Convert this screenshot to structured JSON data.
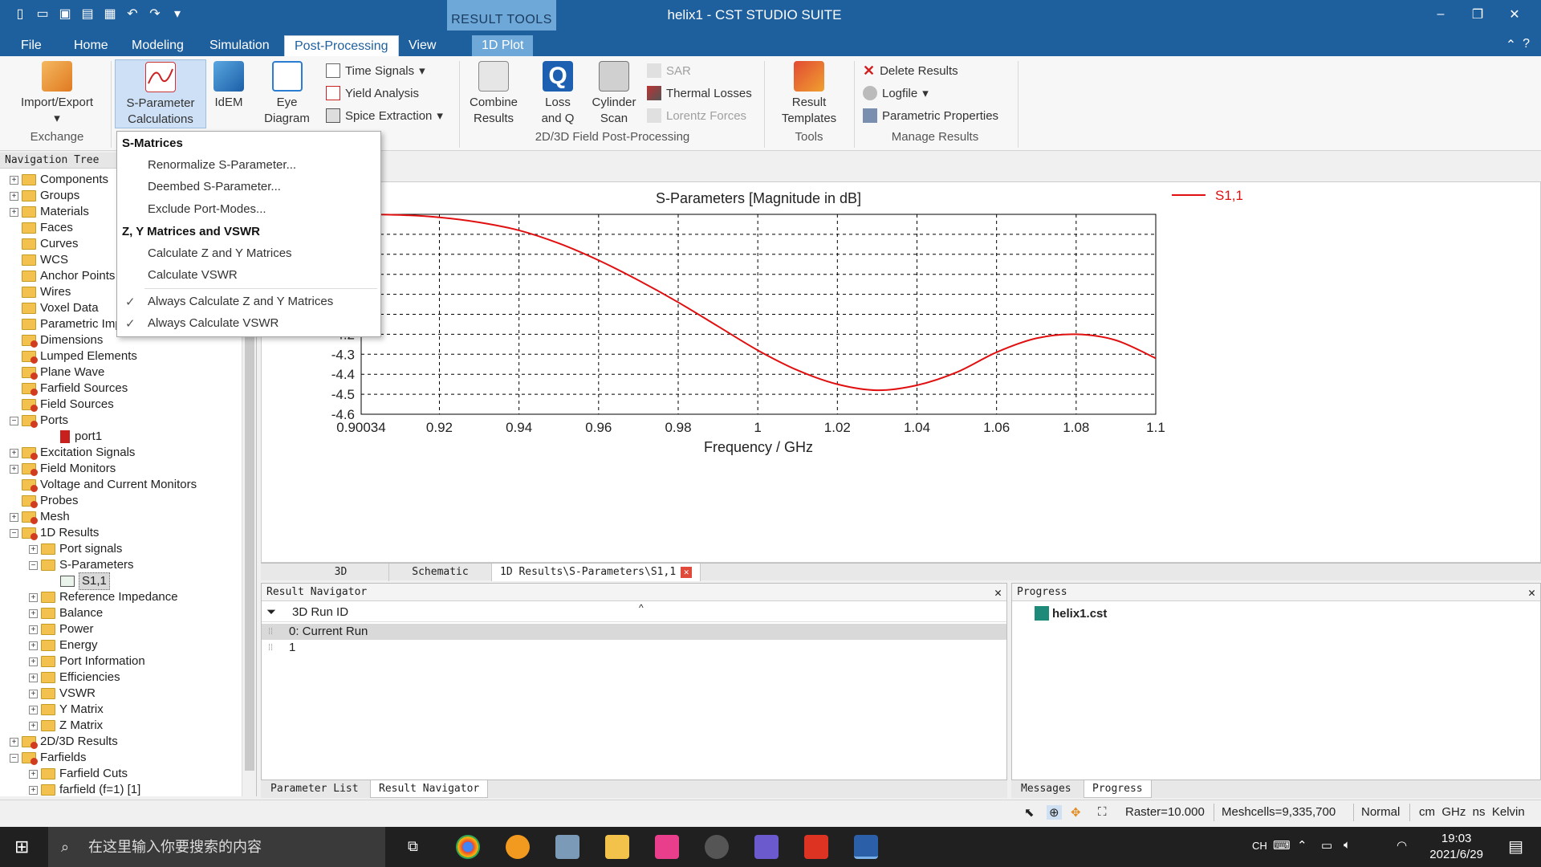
{
  "window": {
    "title": "helix1 - CST STUDIO SUITE",
    "minimize": "–",
    "restore": "❐",
    "close": "✕"
  },
  "context_group": {
    "label": "RESULT TOOLS",
    "tab": "1D Plot"
  },
  "tabs": [
    "File",
    "Home",
    "Modeling",
    "Simulation",
    "Post-Processing",
    "View"
  ],
  "ribbon": {
    "import_export": "Import/Export",
    "exchange_group": "Exchange",
    "sparam_calc": "S-Parameter Calculations",
    "idem": "IdEM",
    "eye_diagram": "Eye Diagram",
    "time_signals": "Time Signals",
    "yield_analysis": "Yield Analysis",
    "spice_extraction": "Spice Extraction",
    "combine_results": "Combine Results",
    "loss_and_q": "Loss and Q",
    "cylinder_scan": "Cylinder Scan",
    "sar": "SAR",
    "thermal_losses": "Thermal Losses",
    "lorentz_forces": "Lorentz Forces",
    "field_group": "2D/3D Field Post-Processing",
    "result_templates": "Result Templates",
    "tools_group": "Tools",
    "delete_results": "Delete Results",
    "logfile": "Logfile",
    "parametric_properties": "Parametric Properties",
    "manage_group": "Manage Results"
  },
  "menu": {
    "header1": "S-Matrices",
    "renormalize": "Renormalize S-Parameter...",
    "deembed": "Deembed S-Parameter...",
    "exclude": "Exclude Port-Modes...",
    "header2": "Z, Y Matrices and VSWR",
    "calc_zy": "Calculate Z and Y Matrices",
    "calc_vswr": "Calculate VSWR",
    "always_zy": "Always Calculate Z and Y Matrices",
    "always_vswr": "Always Calculate VSWR"
  },
  "navtree": {
    "title": "Navigation Tree",
    "items": [
      {
        "label": "Components",
        "level": 0,
        "exp": "+"
      },
      {
        "label": "Groups",
        "level": 0,
        "exp": "+"
      },
      {
        "label": "Materials",
        "level": 0,
        "exp": "+"
      },
      {
        "label": "Faces",
        "level": 0,
        "exp": ""
      },
      {
        "label": "Curves",
        "level": 0,
        "exp": ""
      },
      {
        "label": "WCS",
        "level": 0,
        "exp": ""
      },
      {
        "label": "Anchor Points",
        "level": 0,
        "exp": ""
      },
      {
        "label": "Wires",
        "level": 0,
        "exp": ""
      },
      {
        "label": "Voxel Data",
        "level": 0,
        "exp": ""
      },
      {
        "label": "Parametric Imports",
        "level": 0,
        "exp": ""
      },
      {
        "label": "Dimensions",
        "level": 0,
        "exp": ""
      },
      {
        "label": "Lumped Elements",
        "level": 0,
        "exp": ""
      },
      {
        "label": "Plane Wave",
        "level": 0,
        "exp": ""
      },
      {
        "label": "Farfield Sources",
        "level": 0,
        "exp": ""
      },
      {
        "label": "Field Sources",
        "level": 0,
        "exp": ""
      },
      {
        "label": "Ports",
        "level": 0,
        "exp": "−"
      },
      {
        "label": "port1",
        "level": 2,
        "exp": "",
        "icon": "port"
      },
      {
        "label": "Excitation Signals",
        "level": 0,
        "exp": "+"
      },
      {
        "label": "Field Monitors",
        "level": 0,
        "exp": "+"
      },
      {
        "label": "Voltage and Current Monitors",
        "level": 0,
        "exp": ""
      },
      {
        "label": "Probes",
        "level": 0,
        "exp": ""
      },
      {
        "label": "Mesh",
        "level": 0,
        "exp": "+"
      },
      {
        "label": "1D Results",
        "level": 0,
        "exp": "−"
      },
      {
        "label": "Port signals",
        "level": 1,
        "exp": "+"
      },
      {
        "label": "S-Parameters",
        "level": 1,
        "exp": "−"
      },
      {
        "label": "S1,1",
        "level": 2,
        "exp": "",
        "icon": "curve",
        "selected": true
      },
      {
        "label": "Reference Impedance",
        "level": 1,
        "exp": "+"
      },
      {
        "label": "Balance",
        "level": 1,
        "exp": "+"
      },
      {
        "label": "Power",
        "level": 1,
        "exp": "+"
      },
      {
        "label": "Energy",
        "level": 1,
        "exp": "+"
      },
      {
        "label": "Port Information",
        "level": 1,
        "exp": "+"
      },
      {
        "label": "Efficiencies",
        "level": 1,
        "exp": "+"
      },
      {
        "label": "VSWR",
        "level": 1,
        "exp": "+"
      },
      {
        "label": "Y Matrix",
        "level": 1,
        "exp": "+"
      },
      {
        "label": "Z Matrix",
        "level": 1,
        "exp": "+"
      },
      {
        "label": "2D/3D Results",
        "level": 0,
        "exp": "+"
      },
      {
        "label": "Farfields",
        "level": 0,
        "exp": "−"
      },
      {
        "label": "Farfield Cuts",
        "level": 1,
        "exp": "+"
      },
      {
        "label": "farfield (f=1) [1]",
        "level": 1,
        "exp": "+"
      }
    ]
  },
  "chart_data": {
    "type": "line",
    "title": "S-Parameters [Magnitude in dB]",
    "xlabel": "Frequency / GHz",
    "ylabel": "dB",
    "xlim": [
      0.90034,
      1.1
    ],
    "ylim": [
      -4.6,
      -3.6
    ],
    "x_ticks": [
      "0.90034",
      "0.92",
      "0.94",
      "0.96",
      "0.98",
      "1",
      "1.02",
      "1.04",
      "1.06",
      "1.08",
      "1.1"
    ],
    "y_ticks": [
      "-4.1",
      "-4.2",
      "-4.3",
      "-4.4",
      "-4.5",
      "-4.6"
    ],
    "grid": true,
    "legend": "right",
    "series": [
      {
        "name": "S1,1",
        "color": "#e01010",
        "x": [
          0.90034,
          0.91,
          0.92,
          0.93,
          0.94,
          0.95,
          0.96,
          0.97,
          0.98,
          0.99,
          1.0,
          1.01,
          1.02,
          1.03,
          1.04,
          1.05,
          1.06,
          1.07,
          1.08,
          1.09,
          1.1
        ],
        "y": [
          -3.6,
          -3.603,
          -3.615,
          -3.64,
          -3.68,
          -3.745,
          -3.83,
          -3.93,
          -4.04,
          -4.16,
          -4.28,
          -4.38,
          -4.45,
          -4.48,
          -4.455,
          -4.39,
          -4.29,
          -4.22,
          -4.2,
          -4.23,
          -4.32
        ]
      }
    ]
  },
  "view_tabs": [
    "3D",
    "Schematic",
    "1D Results\\S-Parameters\\S1,1"
  ],
  "result_navigator": {
    "title": "Result Navigator",
    "column": "3D Run ID",
    "rows": [
      "0: Current Run",
      "1"
    ]
  },
  "progress_panel": {
    "title": "Progress",
    "file": "helix1.cst"
  },
  "bottom_tabs_left": [
    "Parameter List",
    "Result Navigator"
  ],
  "bottom_tabs_right": [
    "Messages",
    "Progress"
  ],
  "status": {
    "raster": "Raster=10.000",
    "meshcells": "Meshcells=9,335,700",
    "mode": "Normal",
    "units": "cm  GHz  ns  Kelvin"
  },
  "taskbar": {
    "search_placeholder": "在这里输入你要搜索的内容",
    "time": "19:03",
    "date": "2021/6/29",
    "ime": "CH"
  }
}
